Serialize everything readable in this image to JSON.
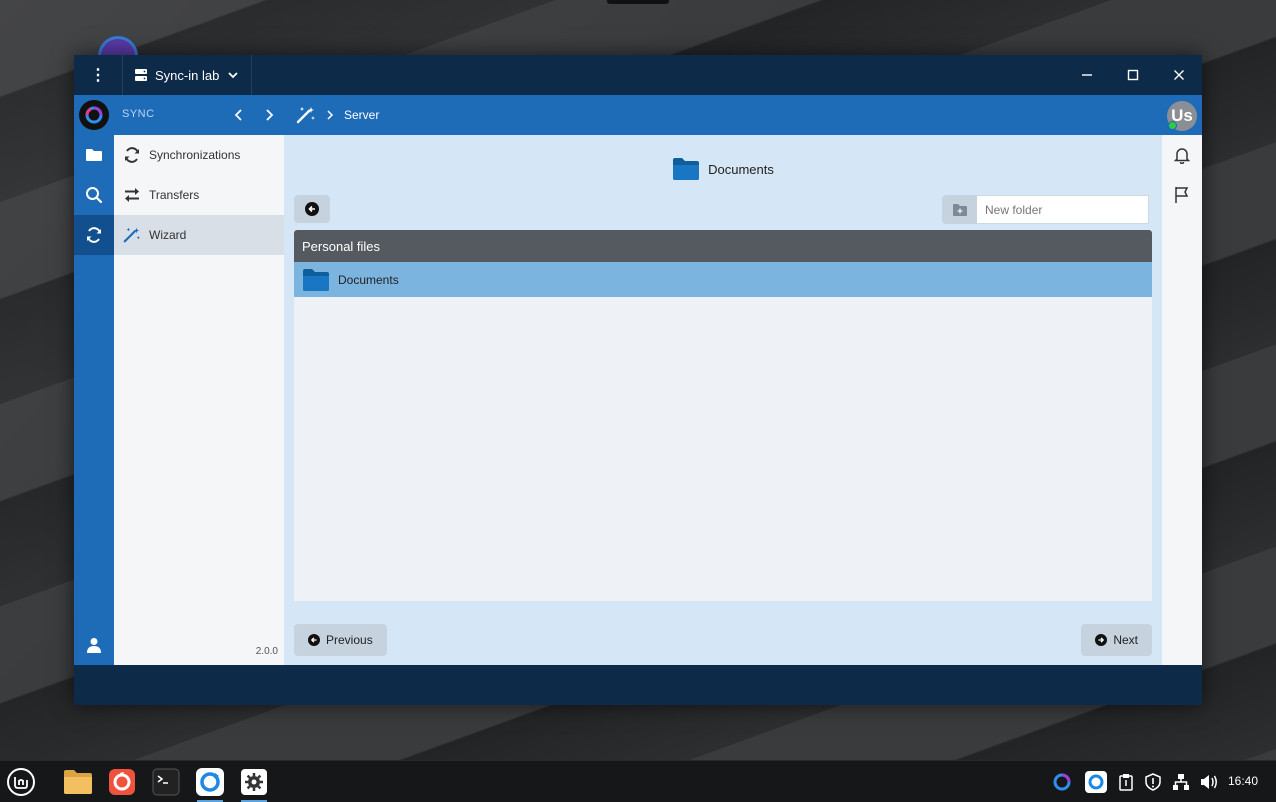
{
  "window": {
    "server_name": "Sync-in lab",
    "menu_glyph": "⋮"
  },
  "topbar": {
    "section_label": "SYNC",
    "breadcrumb": "Server",
    "avatar_initials": "Us"
  },
  "sidebar": {
    "items": [
      {
        "label": "Synchronizations",
        "icon": "sync-icon"
      },
      {
        "label": "Transfers",
        "icon": "transfer-icon"
      },
      {
        "label": "Wizard",
        "icon": "magic-wand-icon",
        "active": true
      }
    ],
    "version": "2.0.0"
  },
  "main": {
    "title": "Documents",
    "new_folder_placeholder": "New folder",
    "panel_header": "Personal files",
    "rows": [
      {
        "label": "Documents"
      }
    ],
    "previous_label": "Previous",
    "next_label": "Next"
  },
  "taskbar": {
    "clock": "16:40"
  },
  "colors": {
    "accent": "#1e6bb8",
    "titlebar": "#0d2a48",
    "selected_row": "#7cb4e0",
    "panel_header": "#555a60"
  }
}
